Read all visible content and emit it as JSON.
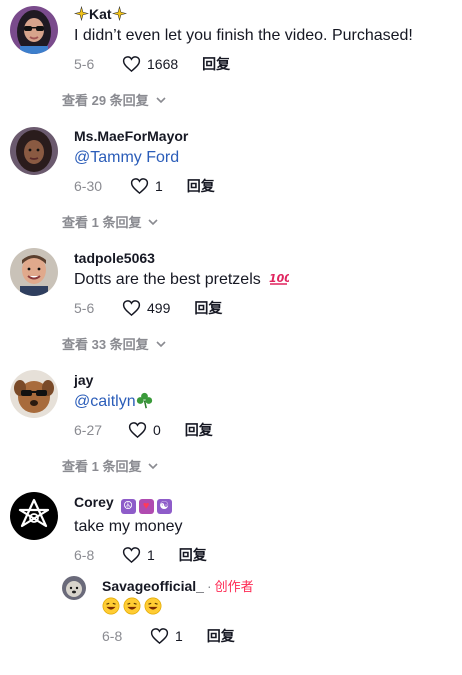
{
  "comments": [
    {
      "username": "Kat",
      "text": "I didn’t even let you finish the video. Purchased!",
      "date": "5-6",
      "likes": "1668",
      "reply": "回复",
      "view_more": "查看 29 条回复",
      "avatar_icon": "user-avatar-woman-glasses"
    },
    {
      "username": "Ms.MaeForMayor",
      "text": "@Tammy Ford",
      "date": "6-30",
      "likes": "1",
      "reply": "回复",
      "view_more": "查看 1 条回复",
      "avatar_icon": "user-avatar-woman"
    },
    {
      "username": "tadpole5063",
      "text": "Dotts are the best pretzels",
      "emoji": "hundred-points-icon",
      "date": "5-6",
      "likes": "499",
      "reply": "回复",
      "view_more": "查看 33 条回复",
      "avatar_icon": "user-avatar-man"
    },
    {
      "username": "jay",
      "text": "@caitlyn",
      "emoji": "shamrock-icon",
      "date": "6-27",
      "likes": "0",
      "reply": "回复",
      "view_more": "查看 1 条回复",
      "avatar_icon": "user-avatar-dog-sunglasses"
    },
    {
      "username": "Corey",
      "badges": [
        "peace-icon",
        "heart-icon",
        "yin-yang-icon"
      ],
      "text": "take my money",
      "date": "6-8",
      "likes": "1",
      "reply": "回复",
      "avatar_icon": "unicursal-hexagram-icon"
    }
  ],
  "creator_reply": {
    "username": "Savageofficial_",
    "separator": "·",
    "creator_label": "创作者",
    "emojis": [
      "laughing-icon",
      "laughing-icon",
      "laughing-icon"
    ],
    "date": "6-8",
    "likes": "1",
    "reply": "回复",
    "avatar_icon": "user-avatar-dog"
  }
}
